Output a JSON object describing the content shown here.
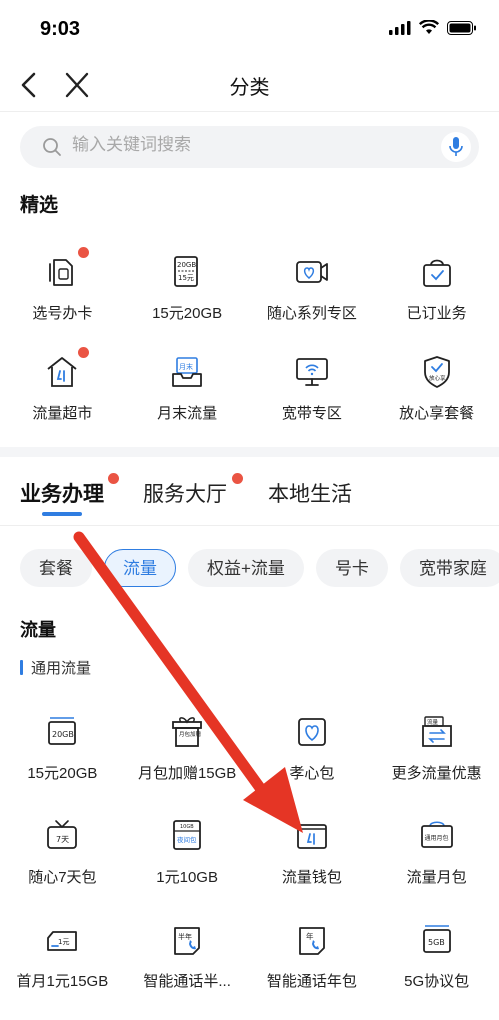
{
  "status": {
    "time": "9:03"
  },
  "nav": {
    "title": "分类"
  },
  "search": {
    "placeholder": "输入关键词搜索"
  },
  "featured": {
    "title": "精选",
    "items": [
      {
        "label": "选号办卡",
        "icon": "sim-card-icon",
        "dot": true
      },
      {
        "label": "15元20GB",
        "icon": "data-20gb-icon",
        "dot": false
      },
      {
        "label": "随心系列专区",
        "icon": "video-heart-icon",
        "dot": false
      },
      {
        "label": "已订业务",
        "icon": "subscribed-bag-icon",
        "dot": false
      },
      {
        "label": "流量超市",
        "icon": "data-store-icon",
        "dot": true
      },
      {
        "label": "月末流量",
        "icon": "month-end-icon",
        "dot": false
      },
      {
        "label": "宽带专区",
        "icon": "broadband-icon",
        "dot": false
      },
      {
        "label": "放心享套餐",
        "icon": "shield-plan-icon",
        "dot": false
      }
    ]
  },
  "tabs": [
    {
      "label": "业务办理",
      "active": true,
      "dot": true
    },
    {
      "label": "服务大厅",
      "active": false,
      "dot": true
    },
    {
      "label": "本地生活",
      "active": false,
      "dot": false
    }
  ],
  "chips": [
    {
      "label": "套餐",
      "active": false
    },
    {
      "label": "流量",
      "active": true
    },
    {
      "label": "权益+流量",
      "active": false
    },
    {
      "label": "号卡",
      "active": false
    },
    {
      "label": "宽带家庭",
      "active": false
    }
  ],
  "traffic": {
    "title": "流量",
    "subtitle": "通用流量",
    "items": [
      {
        "label": "15元20GB",
        "icon": "data-20gb-card-icon"
      },
      {
        "label": "月包加赠15GB",
        "icon": "gift-box-icon"
      },
      {
        "label": "孝心包",
        "icon": "heart-card-icon"
      },
      {
        "label": "更多流量优惠",
        "icon": "exchange-icon"
      },
      {
        "label": "随心7天包",
        "icon": "tv-7day-icon"
      },
      {
        "label": "1元10GB",
        "icon": "night-pack-icon"
      },
      {
        "label": "流量钱包",
        "icon": "wallet-icon"
      },
      {
        "label": "流量月包",
        "icon": "monthly-pack-icon"
      },
      {
        "label": "首月1元15GB",
        "icon": "ticket-icon"
      },
      {
        "label": "智能通话半...",
        "icon": "half-year-call-icon"
      },
      {
        "label": "智能通话年包",
        "icon": "year-call-icon"
      },
      {
        "label": "5G协议包",
        "icon": "5g-pack-icon"
      }
    ]
  },
  "icon_texts": {
    "gb20": "20GB",
    "yuan15": "15元",
    "month_end": "月末",
    "shield": "放心享",
    "month_gift": "月包加赠",
    "flow": "流量",
    "seven_day": "7天",
    "night": "夜间包",
    "pack_10gb": "10GB",
    "monthly": "通用月包",
    "one_yuan": "1元",
    "half_year": "半年",
    "year": "年",
    "five_g": "5GB"
  },
  "colors": {
    "accent": "#2f7de1",
    "dot": "#ea5443",
    "arrow": "#e53525"
  }
}
